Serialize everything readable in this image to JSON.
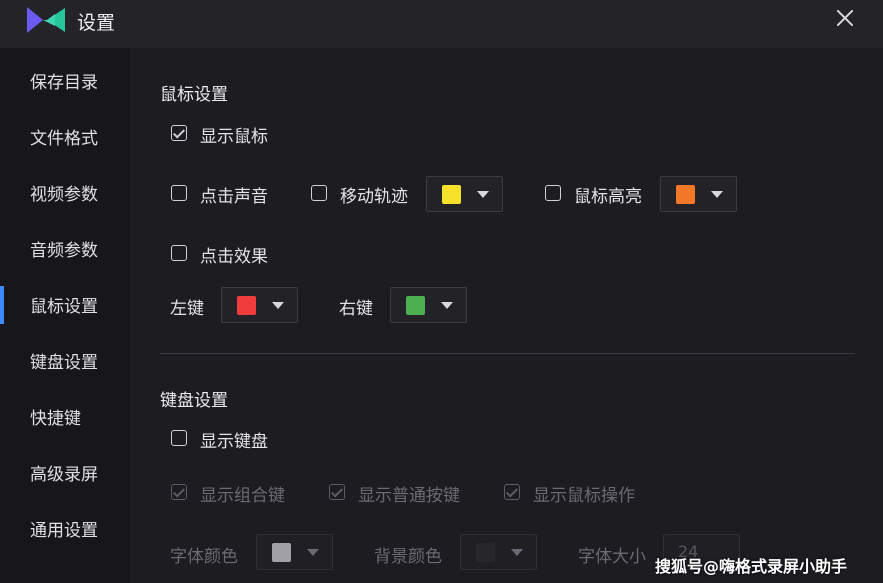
{
  "window": {
    "title": "设置"
  },
  "sidebar": {
    "items": [
      {
        "label": "保存目录"
      },
      {
        "label": "文件格式"
      },
      {
        "label": "视频参数"
      },
      {
        "label": "音频参数"
      },
      {
        "label": "鼠标设置",
        "active": true
      },
      {
        "label": "键盘设置"
      },
      {
        "label": "快捷键"
      },
      {
        "label": "高级录屏"
      },
      {
        "label": "通用设置"
      }
    ]
  },
  "mouse": {
    "title": "鼠标设置",
    "show_cursor": {
      "label": "显示鼠标",
      "checked": true
    },
    "click_sound": {
      "label": "点击声音",
      "checked": false
    },
    "move_trail": {
      "label": "移动轨迹",
      "checked": false,
      "color": "#f5e02c"
    },
    "highlight": {
      "label": "鼠标高亮",
      "checked": false,
      "color": "#f07828"
    },
    "click_effect": {
      "label": "点击效果",
      "checked": false
    },
    "left_key": {
      "label": "左键",
      "color": "#f03c3c"
    },
    "right_key": {
      "label": "右键",
      "color": "#4caf50"
    }
  },
  "keyboard": {
    "title": "键盘设置",
    "show_keyboard": {
      "label": "显示键盘",
      "checked": false
    },
    "combo_keys": {
      "label": "显示组合键",
      "checked": true
    },
    "normal_keys": {
      "label": "显示普通按键",
      "checked": true
    },
    "mouse_ops": {
      "label": "显示鼠标操作",
      "checked": true
    },
    "font_color": {
      "label": "字体颜色",
      "color": "#a0a0a6"
    },
    "bg_color": {
      "label": "背景颜色",
      "color": "#26262b"
    },
    "font_size": {
      "label": "字体大小",
      "value": "24"
    }
  },
  "watermark": "搜狐号@嗨格式录屏小助手"
}
